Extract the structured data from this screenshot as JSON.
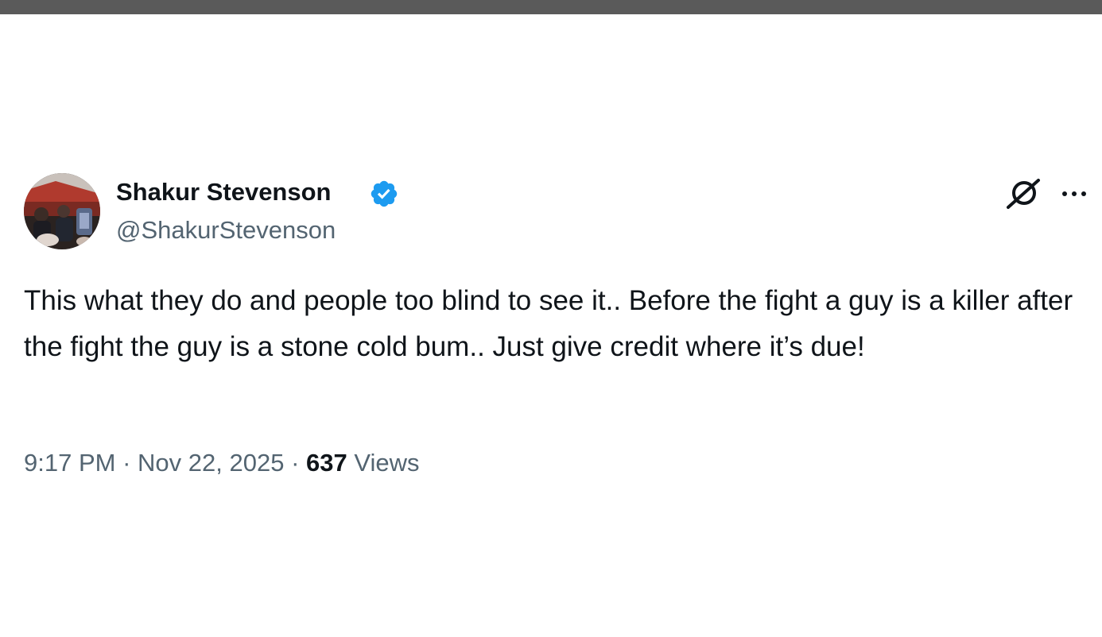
{
  "tweet": {
    "author": {
      "display_name": "Shakur Stevenson",
      "handle": "@ShakurStevenson",
      "verified": true,
      "verified_color": "#1d9bf0"
    },
    "text": "This what they do and people too blind to see it.. Before the fight a guy is a killer after the fight the guy is a stone cold bum.. Just give credit where it’s due!",
    "time": "9:17 PM",
    "separator": "·",
    "date": "Nov 22, 2025",
    "views_count": "637",
    "views_label": "Views",
    "icons": {
      "grok": "grok-icon",
      "more": "more-options-icon",
      "verified": "verified-badge-icon"
    }
  },
  "colors": {
    "text_primary": "#0f1419",
    "text_secondary": "#536471",
    "top_bar": "#5a5a5a",
    "background": "#ffffff"
  }
}
